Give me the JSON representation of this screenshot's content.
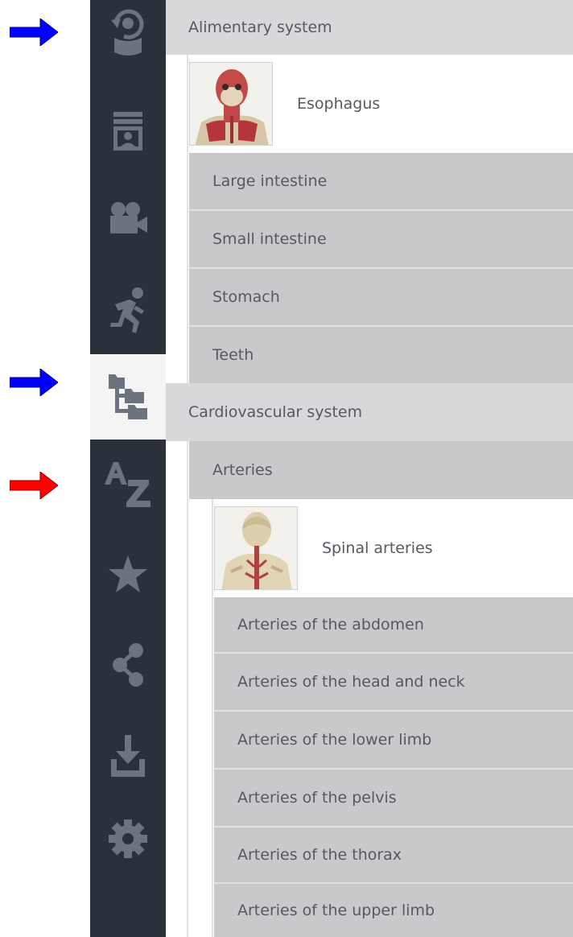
{
  "annotations": {
    "arrows": [
      {
        "name": "blue-arrow-top",
        "color": "#0000ff"
      },
      {
        "name": "blue-arrow-middle",
        "color": "#0000ff"
      },
      {
        "name": "red-arrow",
        "color": "#ff0000"
      }
    ]
  },
  "sidebar": {
    "background": "#2b313a",
    "active_background": "#f4f4f4",
    "icon_color": "#6b737e",
    "items": [
      {
        "name": "view-360-icon",
        "active": false
      },
      {
        "name": "layers-stack-icon",
        "active": false
      },
      {
        "name": "video-camera-icon",
        "active": false
      },
      {
        "name": "running-person-icon",
        "active": false
      },
      {
        "name": "tree-hierarchy-icon",
        "active": true
      },
      {
        "name": "a-z-icon",
        "active": false
      },
      {
        "name": "star-icon",
        "active": false
      },
      {
        "name": "share-icon",
        "active": false
      },
      {
        "name": "download-icon",
        "active": false
      },
      {
        "name": "gear-icon",
        "active": false
      }
    ],
    "az_label": "AZ"
  },
  "tree": {
    "alimentary": {
      "label": "Alimentary system",
      "esophagus": "Esophagus",
      "items": [
        "Large intestine",
        "Small intestine",
        "Stomach",
        "Teeth"
      ]
    },
    "cardiovascular": {
      "label": "Cardiovascular system",
      "arteries": {
        "label": "Arteries",
        "spinal": "Spinal arteries",
        "items": [
          "Arteries of the abdomen",
          "Arteries of the head and neck",
          "Arteries of the lower limb",
          "Arteries of the pelvis",
          "Arteries of the thorax",
          "Arteries of the upper limb"
        ]
      }
    }
  }
}
